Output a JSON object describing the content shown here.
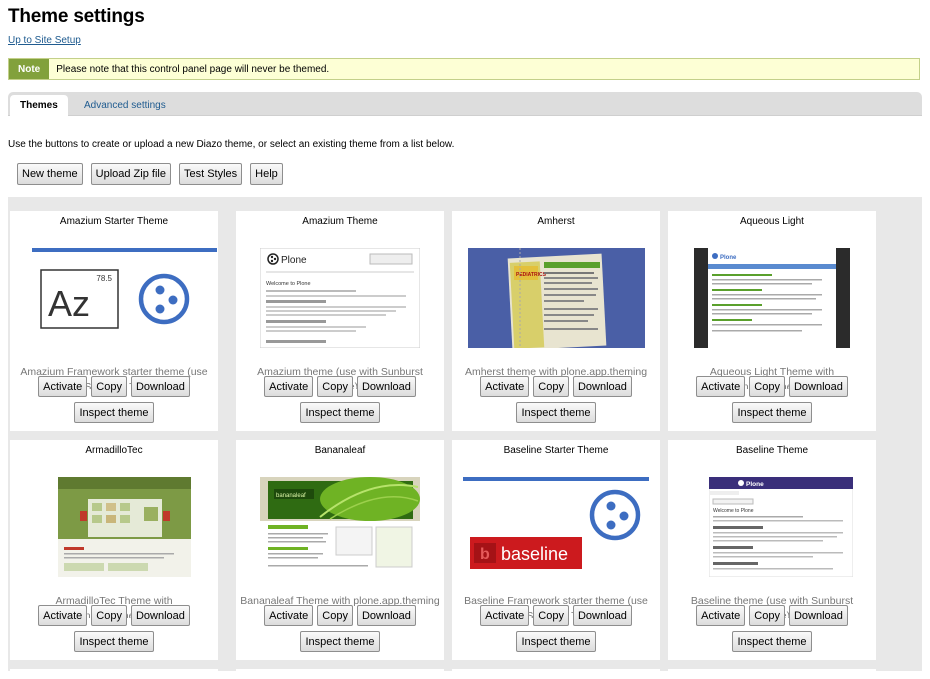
{
  "page": {
    "title": "Theme settings",
    "up_link": "Up to Site Setup",
    "note_label": "Note",
    "note_text": "Please note that this control panel page will never be themed.",
    "tabs": [
      "Themes",
      "Advanced settings"
    ],
    "intro": "Use the buttons to create or upload a new Diazo theme, or select an existing theme from a list below.",
    "toolbar": [
      "New theme",
      "Upload Zip file",
      "Test Styles",
      "Help"
    ]
  },
  "card_buttons": {
    "activate": "Activate",
    "copy": "Copy",
    "download": "Download",
    "inspect": "Inspect theme"
  },
  "themes": [
    {
      "title": "Amazium Starter Theme",
      "description": "Amazium Framework starter theme (use with Sunburst Theme)"
    },
    {
      "title": "Amazium Theme",
      "description": "Amazium theme (use with Sunburst Theme)"
    },
    {
      "title": "Amherst",
      "description": "Amherst theme with plone.app.theming"
    },
    {
      "title": "Aqueous Light",
      "description": "Aqueous Light Theme with plone.app.theming"
    },
    {
      "title": "ArmadilloTec",
      "description": "ArmadilloTec Theme with plone.app.theming"
    },
    {
      "title": "Bananaleaf",
      "description": "Bananaleaf Theme with plone.app.theming"
    },
    {
      "title": "Baseline Starter Theme",
      "description": "Baseline Framework starter theme (use with Sunburst Theme)"
    },
    {
      "title": "Baseline Theme",
      "description": "Baseline theme (use with Sunburst Theme)"
    }
  ],
  "thumb_text": {
    "az_number": "78.5",
    "az_letters": "Az",
    "plone_word": "Plone",
    "plone_welcome": "Welcome to Plone",
    "amherst_badge": "PEDIATRICS",
    "aqueous_logo": "Plone",
    "bananaleaf_logo": "bananaleaf",
    "baseline_word": "baseline",
    "baseline_b": "b",
    "baseline_theme_logo": "Plone",
    "baseline_theme_welcome": "Welcome to Plone"
  },
  "colors": {
    "note_label_bg": "#82a13c",
    "note_bg": "#fdffd5",
    "link": "#205c90",
    "plone_blue": "#3d6dc1",
    "baseline_red": "#cc1a1e"
  }
}
